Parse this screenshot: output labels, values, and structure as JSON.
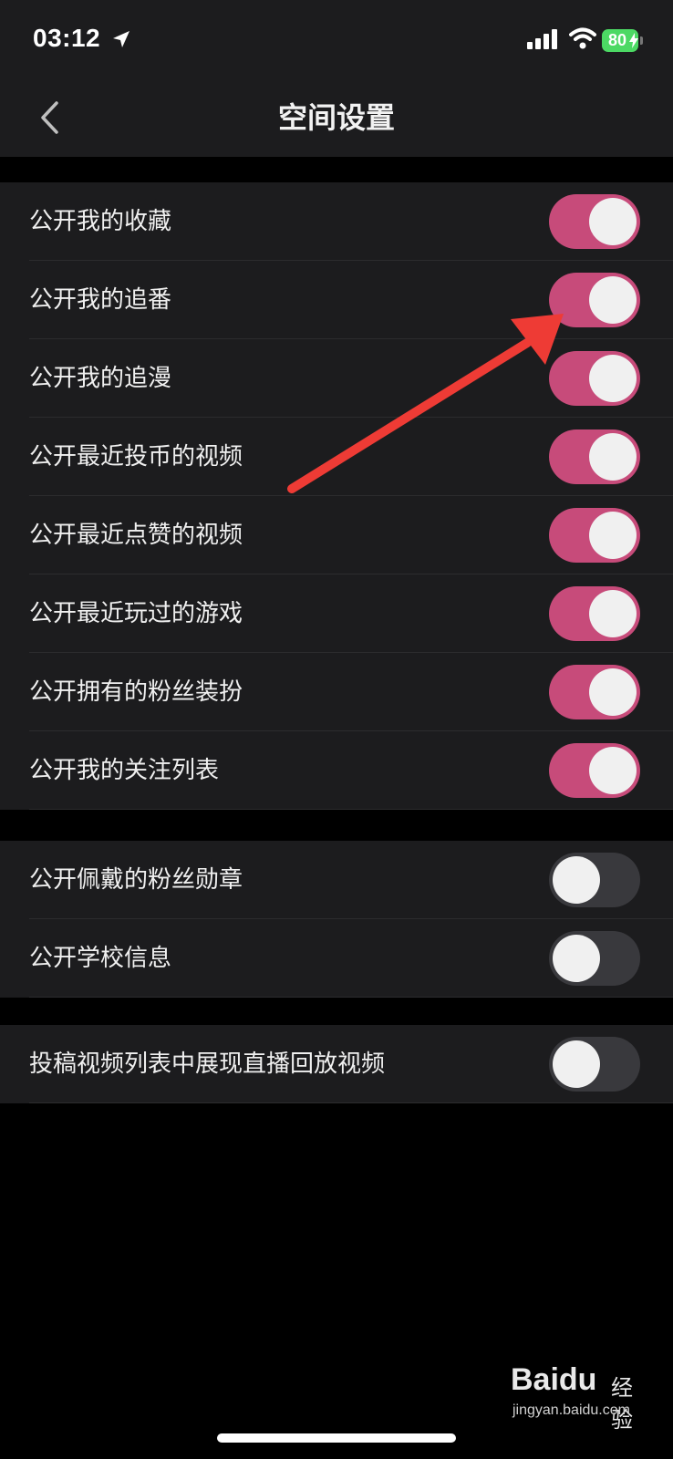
{
  "status_bar": {
    "time": "03:12",
    "battery_percent": "80",
    "icons": [
      "location-arrow-icon",
      "signal-bars-icon",
      "wifi-icon",
      "battery-charging-icon"
    ]
  },
  "nav": {
    "title": "空间设置",
    "back_icon": "chevron-left-icon"
  },
  "colors": {
    "toggle_on": "#c74b7a",
    "toggle_off": "#39393d",
    "annotation_arrow": "#ee3b35"
  },
  "groups": [
    {
      "items": [
        {
          "label": "公开我的收藏",
          "on": true
        },
        {
          "label": "公开我的追番",
          "on": true
        },
        {
          "label": "公开我的追漫",
          "on": true
        },
        {
          "label": "公开最近投币的视频",
          "on": true
        },
        {
          "label": "公开最近点赞的视频",
          "on": true
        },
        {
          "label": "公开最近玩过的游戏",
          "on": true
        },
        {
          "label": "公开拥有的粉丝装扮",
          "on": true
        },
        {
          "label": "公开我的关注列表",
          "on": true
        }
      ]
    },
    {
      "items": [
        {
          "label": "公开佩戴的粉丝勋章",
          "on": false
        },
        {
          "label": "公开学校信息",
          "on": false
        }
      ]
    },
    {
      "items": [
        {
          "label": "投稿视频列表中展现直播回放视频",
          "on": false
        }
      ]
    }
  ],
  "watermark": {
    "logo": "Baidu",
    "suffix": "经验",
    "url": "jingyan.baidu.com"
  }
}
